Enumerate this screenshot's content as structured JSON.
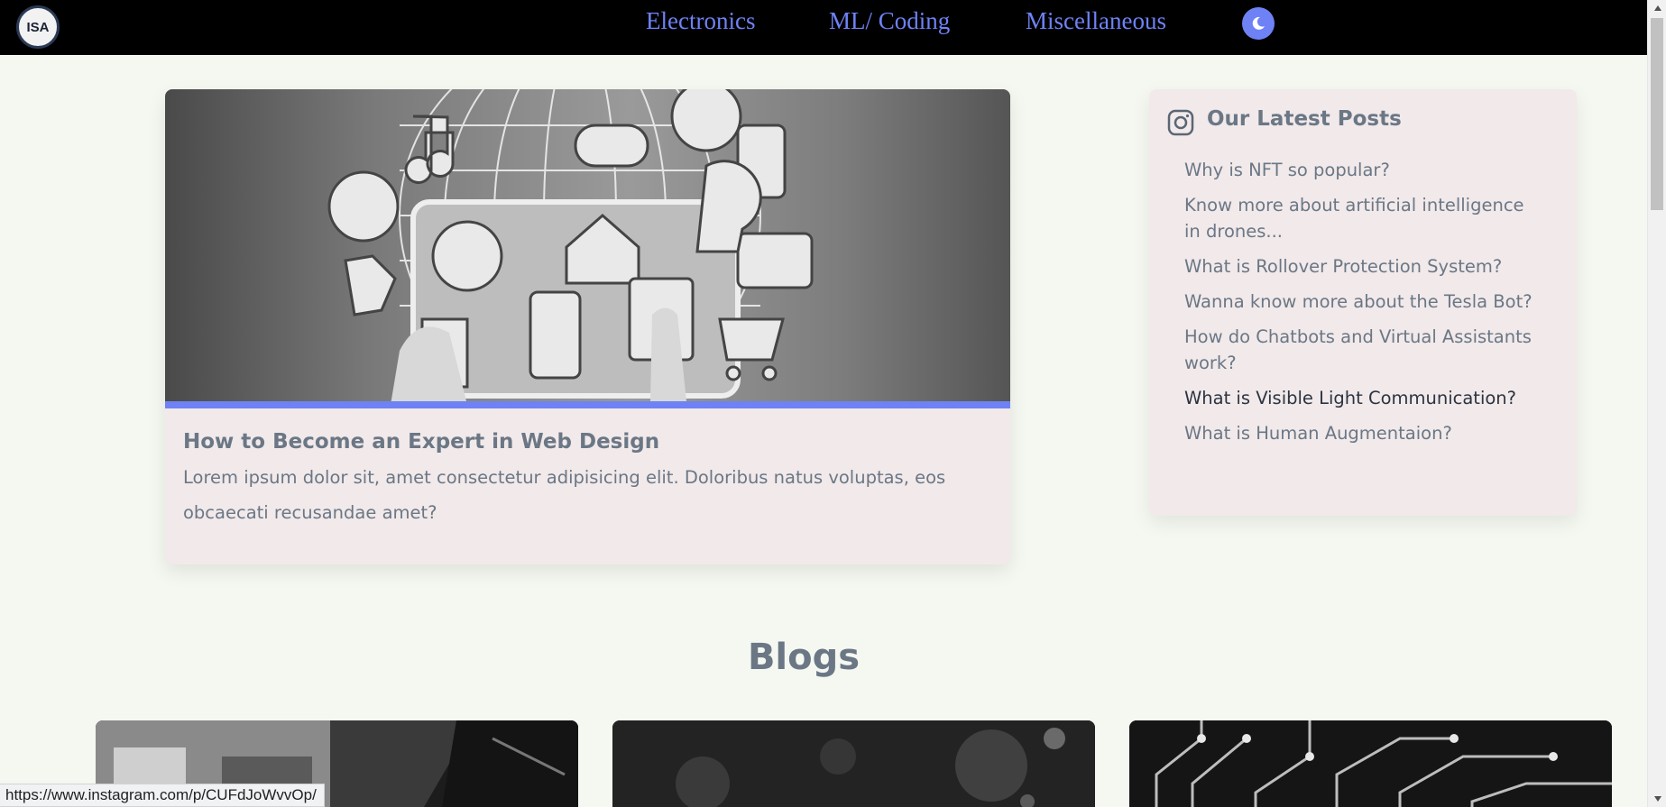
{
  "navbar": {
    "logo_text": "ISA",
    "links": [
      "Electronics",
      "ML/ Coding",
      "Miscellaneous"
    ],
    "theme_toggle_icon": "moon-icon"
  },
  "featured": {
    "image_icon": "connected-devices-globe-image",
    "title": "How to Become an Expert in Web Design",
    "text": "Lorem ipsum dolor sit, amet consectetur adipisicing elit. Doloribus natus voluptas, eos obcaecati recusandae amet?"
  },
  "sidebar": {
    "icon": "instagram-icon",
    "title": "Our Latest Posts",
    "posts": [
      "Why is NFT so popular?",
      "Know more about artificial intelligence in drones...",
      "What is Rollover Protection System?",
      "Wanna know more about the Tesla Bot?",
      "How do Chatbots and Virtual Assistants work?",
      "What is Visible Light Communication?",
      "What is Human Augmentaion?"
    ],
    "hovered_post_index": 5
  },
  "blogs": {
    "heading": "Blogs",
    "cards": [
      {
        "image": "circuit-board-usb-image"
      },
      {
        "image": "bokeh-dark-image"
      },
      {
        "image": "circuit-traces-image"
      }
    ]
  },
  "status_bar": {
    "url": "https://www.instagram.com/p/CUFdJoWvvOp/"
  },
  "colors": {
    "accent": "#6e82f5",
    "page_bg": "#f5f8f1",
    "card_bg": "#f1e9ea",
    "text": "#6b7785"
  }
}
